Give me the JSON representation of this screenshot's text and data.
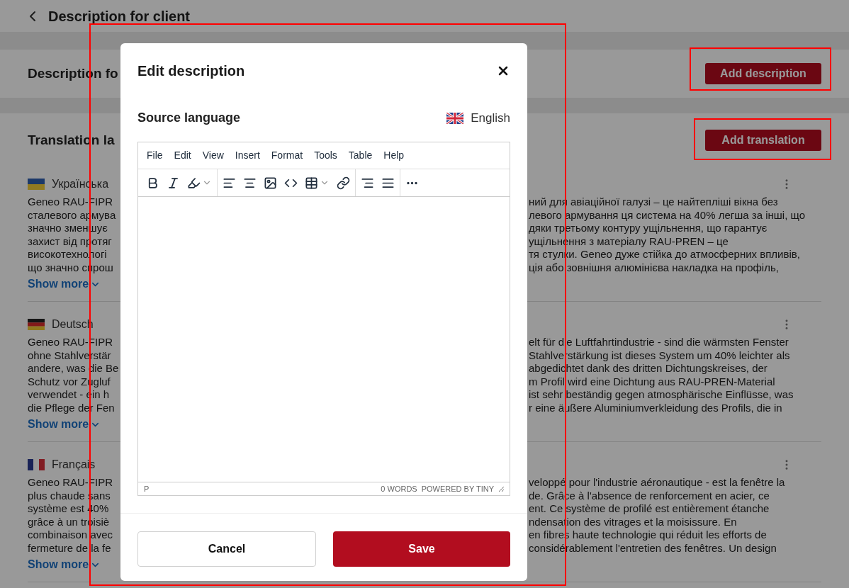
{
  "page": {
    "title": "Description for client"
  },
  "client_section": {
    "title": "Description fo",
    "button": "Add description"
  },
  "translations_section": {
    "title": "Translation la",
    "button": "Add translation",
    "items": [
      {
        "language": "Українська",
        "kind": "ua",
        "show_more": "Show more",
        "lines": [
          {
            "left": "Geneo RAU-FIPR",
            "right": "ний для авіаційної галузі – це найтепліші вікна без"
          },
          {
            "left": "сталевого армува",
            "right": "левого армування ця система на 40% легша за інші, що"
          },
          {
            "left": "значно зменшує",
            "right": "дяки третьому контуру ущільнення, що гарантує"
          },
          {
            "left": "захист від протяг",
            "right": "ущільнення з матеріалу RAU-PREN – це"
          },
          {
            "left": "високотехнологі",
            "right": "тя стулки. Geneo дуже стійка до атмосферних впливів,"
          },
          {
            "left": "що значно спрош",
            "right": "ція або зовнішня алюмінієва накладка на профіль,"
          }
        ]
      },
      {
        "language": "Deutsch",
        "kind": "de",
        "show_more": "Show more",
        "lines": [
          {
            "left": "Geneo RAU-FIPR",
            "right": "elt für die Luftfahrtindustrie - sind die wärmsten Fenster"
          },
          {
            "left": "ohne Stahlverstär",
            "right": "Stahlverstärkung ist dieses System um 40% leichter als"
          },
          {
            "left": "andere, was die Be",
            "right": "abgedichtet dank des dritten Dichtungskreises, der"
          },
          {
            "left": "Schutz vor Zugluf",
            "right": "m Profil wird eine Dichtung aus RAU-PREN-Material"
          },
          {
            "left": "verwendet - ein h",
            "right": "ist sehr beständig gegen atmosphärische Einflüsse, was"
          },
          {
            "left": "die Pflege der Fen",
            "right": "r eine äußere Aluminiumverkleidung des Profils, die in"
          }
        ]
      },
      {
        "language": "Français",
        "kind": "fr",
        "show_more": "Show more",
        "lines": [
          {
            "left": "Geneo RAU-FIPR",
            "right": "veloppé pour l'industrie aéronautique - est la fenêtre la"
          },
          {
            "left": "plus chaude sans",
            "right": "de. Grâce à l'absence de renforcement en acier, ce"
          },
          {
            "left": "système est 40%",
            "right": "ent. Ce système de profilé est entièrement étanche"
          },
          {
            "left": "grâce à un troisiè",
            "right": "ndensation des vitrages et la moisissure. En"
          },
          {
            "left": "combinaison avec",
            "right": "en fibres haute technologie qui réduit les efforts de"
          },
          {
            "left": "fermeture de la fe",
            "right": "considérablement l'entretien des fenêtres. Un design"
          }
        ]
      }
    ]
  },
  "dialog": {
    "title": "Edit description",
    "source_label": "Source language",
    "source_language": {
      "name": "English",
      "kind": "gb"
    },
    "menu": [
      "File",
      "Edit",
      "View",
      "Insert",
      "Format",
      "Tools",
      "Table",
      "Help"
    ],
    "status_path": "P",
    "word_count": "0 WORDS",
    "branding": "POWERED BY TINY",
    "buttons": [
      {
        "label": "Cancel",
        "kind": "secondary"
      },
      {
        "label": "Save",
        "kind": "primary"
      }
    ]
  }
}
